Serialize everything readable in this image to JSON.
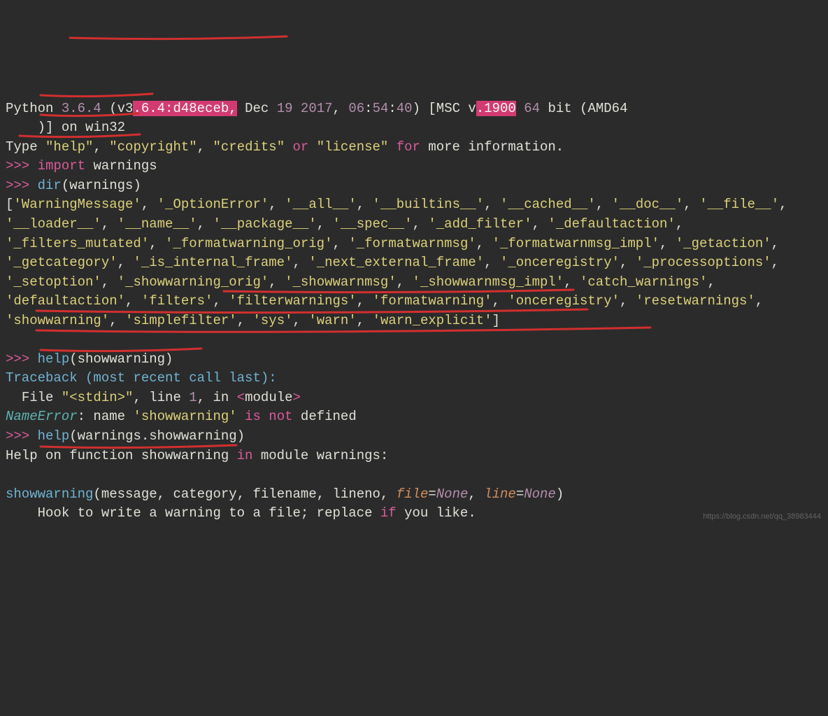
{
  "version_line": {
    "prefix": "Python ",
    "ver": "3.6.4",
    "paren_open": " (v3",
    "hl1": ".6.4:d48eceb,",
    "date_txt": " Dec ",
    "day": "19",
    "sp1": " ",
    "year": "2017",
    "comma": ", ",
    "h": "06",
    "colon1": ":",
    "m": "54",
    "colon2": ":",
    "s": "40",
    "msc": ") [MSC v",
    "hl2": ".1900",
    "bits": " 64",
    "tail": " bit (AMD64",
    "line2": "    )] on win32"
  },
  "type_line": {
    "pre": "Type ",
    "help": "\"help\"",
    "c1": ", ",
    "copyright": "\"copyright\"",
    "c2": ", ",
    "credits": "\"credits\"",
    "or": " or ",
    "license": "\"license\"",
    "for": " for",
    "tail": " more information."
  },
  "lines": {
    "imp": {
      "prompt": ">>> ",
      "kw": "import",
      "sp": " ",
      "mod": "warnings"
    },
    "dir": {
      "prompt": ">>> ",
      "fn": "dir",
      "open": "(",
      "arg": "warnings",
      "close": ")"
    },
    "help1": {
      "prompt": ">>> ",
      "fn": "help",
      "open": "(",
      "arg": "showwarning",
      "close": ")"
    },
    "tb": "Traceback (most recent call last):",
    "tb_file": {
      "pre": "  File ",
      "file": "\"<stdin>\"",
      "mid": ", line ",
      "lineno": "1",
      "in": ", in ",
      "lt": "<",
      "mod": "module",
      "gt": ">"
    },
    "nameerr": {
      "name": "NameError",
      "mid": ": name ",
      "q": "'showwarning'",
      "is": " is ",
      "not": "not",
      "tail": " defined"
    },
    "help2": {
      "prompt": ">>> ",
      "fn": "help",
      "open": "(",
      "arg1": "warnings",
      "dot": ".",
      "arg2": "showwarning",
      "close": ")"
    },
    "helpout1": {
      "pre": "Help on function showwarning ",
      "in": "in",
      "tail": " module warnings:"
    },
    "sig": {
      "fn": "showwarning",
      "open": "(",
      "p1": "message",
      "c1": ", ",
      "p2": "category",
      "c2": ", ",
      "p3": "filename",
      "c3": ", ",
      "p4": "lineno",
      "c4": ", ",
      "p5": "file",
      "eq1": "=",
      "none1": "None",
      "c5": ", ",
      "p6": "line",
      "eq2": "=",
      "none2": "None",
      "close": ")"
    },
    "hook": {
      "pre": "    Hook to write a warning to a file; replace ",
      "if": "if",
      "tail": " you like."
    }
  },
  "dir_items": [
    "WarningMessage",
    "_OptionError",
    "__all__",
    "__builtins__",
    "__cached__",
    "__doc__",
    "__file__",
    "__loader__",
    "__name__",
    "__package__",
    "__spec__",
    "_add_filter",
    "_defaultaction",
    "_filters_mutated",
    "_formatwarning_orig",
    "_formatwarnmsg",
    "_formatwarnmsg_impl",
    "_getaction",
    "_getcategory",
    "_is_internal_frame",
    "_next_external_frame",
    "_onceregistry",
    "_processoptions",
    "_setoption",
    "_showwarning_orig",
    "_showwarnmsg",
    "_showwarnmsg_impl",
    "catch_warnings",
    "defaultaction",
    "filters",
    "filterwarnings",
    "formatwarning",
    "onceregistry",
    "resetwarnings",
    "showwarning",
    "simplefilter",
    "sys",
    "warn",
    "warn_explicit"
  ],
  "watermark": "https://blog.csdn.net/qq_38983444"
}
